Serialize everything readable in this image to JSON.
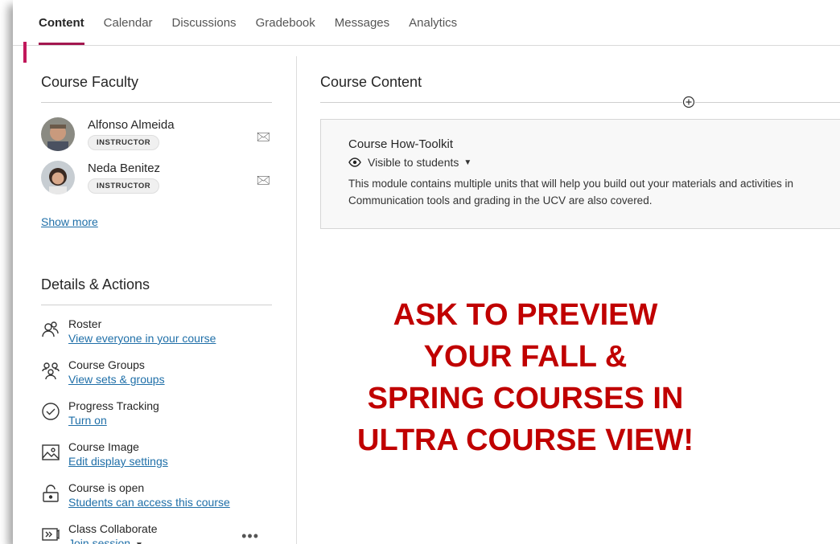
{
  "tabs": [
    "Content",
    "Calendar",
    "Discussions",
    "Gradebook",
    "Messages",
    "Analytics"
  ],
  "active_tab": "Content",
  "faculty": {
    "title": "Course Faculty",
    "members": [
      {
        "name": "Alfonso Almeida",
        "role": "INSTRUCTOR"
      },
      {
        "name": "Neda Benitez",
        "role": "INSTRUCTOR"
      }
    ],
    "show_more": "Show more"
  },
  "details": {
    "title": "Details & Actions",
    "items": [
      {
        "title": "Roster",
        "link": "View everyone in your course",
        "icon": "roster-icon"
      },
      {
        "title": "Course Groups",
        "link": "View sets & groups",
        "icon": "groups-icon"
      },
      {
        "title": "Progress Tracking",
        "link": "Turn on",
        "icon": "check-circle-icon"
      },
      {
        "title": "Course Image",
        "link": "Edit display settings",
        "icon": "image-icon"
      },
      {
        "title": "Course is open",
        "link": "Students can access this course",
        "icon": "unlock-icon"
      },
      {
        "title": "Class Collaborate",
        "link": "Join session",
        "icon": "collaborate-icon"
      }
    ]
  },
  "content": {
    "title": "Course Content",
    "module": {
      "title": "Course How-Toolkit",
      "visibility": "Visible to students",
      "desc_line1": "This module contains multiple units that will help you build out your materials and activities in",
      "desc_line2": "Communication tools and grading in the UCV are also covered."
    }
  },
  "promo": {
    "line1": "ASK TO PREVIEW",
    "line2": "YOUR FALL &",
    "line3": "SPRING COURSES IN",
    "line4": "ULTRA COURSE VIEW!"
  },
  "colors": {
    "accent": "#a3174f",
    "promo": "#c00000",
    "link": "#1f6fa8"
  }
}
